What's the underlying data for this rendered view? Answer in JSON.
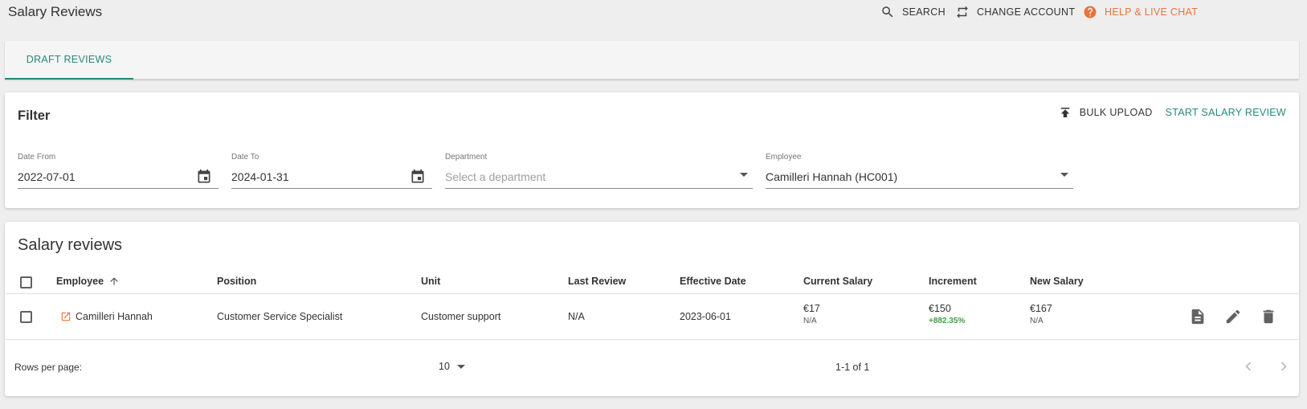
{
  "header": {
    "title": "Salary Reviews",
    "search_label": "SEARCH",
    "change_account_label": "CHANGE ACCOUNT",
    "help_label": "HELP & LIVE CHAT"
  },
  "tabs": [
    {
      "label": "DRAFT REVIEWS",
      "active": true
    }
  ],
  "filter": {
    "title": "Filter",
    "bulk_upload_label": "BULK UPLOAD",
    "start_review_label": "START SALARY REVIEW",
    "date_from": {
      "label": "Date From",
      "value": "2022-07-01"
    },
    "date_to": {
      "label": "Date To",
      "value": "2024-01-31"
    },
    "department": {
      "label": "Department",
      "placeholder": "Select a department",
      "value": ""
    },
    "employee": {
      "label": "Employee",
      "value": "Camilleri Hannah (HC001)"
    }
  },
  "table": {
    "title": "Salary reviews",
    "columns": {
      "employee": "Employee",
      "position": "Position",
      "unit": "Unit",
      "last_review": "Last Review",
      "effective_date": "Effective Date",
      "current_salary": "Current Salary",
      "increment": "Increment",
      "new_salary": "New Salary"
    },
    "sort": {
      "column": "employee",
      "direction": "ascending"
    },
    "rows": [
      {
        "employee": "Camilleri Hannah",
        "position": "Customer Service Specialist",
        "unit": "Customer support",
        "last_review": "N/A",
        "effective_date": "2023-06-01",
        "current_salary": "€17",
        "current_salary_sub": "N/A",
        "increment": "€150",
        "increment_sub": "+882.35%",
        "new_salary": "€167",
        "new_salary_sub": "N/A"
      }
    ],
    "footer": {
      "rows_per_page_label": "Rows per page:",
      "rows_per_page": "10",
      "range": "1-1 of 1"
    }
  },
  "colors": {
    "accent": "#26897b",
    "help": "#e8743b",
    "positive": "#43a047",
    "background": "#eeeeee"
  },
  "icons": {
    "search": "search-icon",
    "change_account": "swap-icon",
    "help": "help-circle-icon",
    "bulk_upload": "upload-icon",
    "calendar": "calendar-icon",
    "open_link": "open-in-new-icon",
    "document": "document-icon",
    "edit": "pencil-icon",
    "delete": "trash-icon",
    "prev": "chevron-left-icon",
    "next": "chevron-right-icon"
  }
}
